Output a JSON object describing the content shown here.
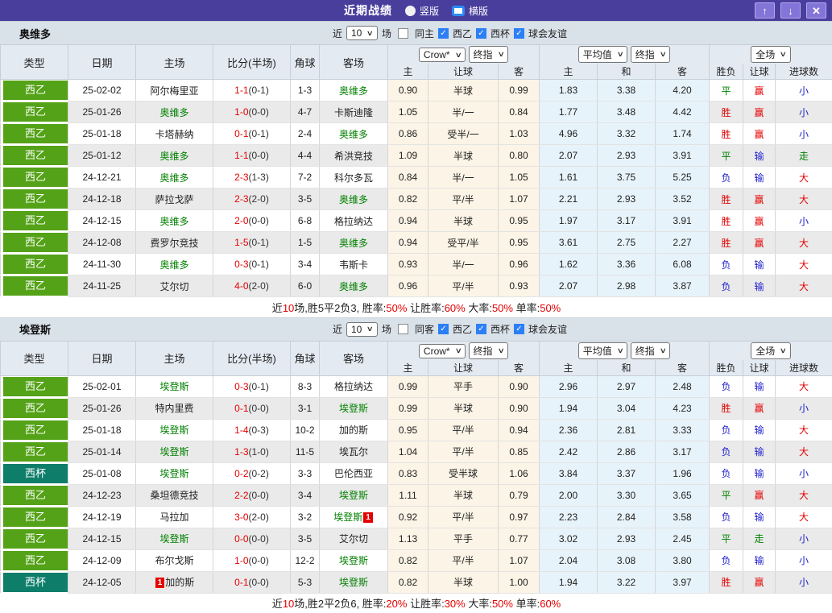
{
  "titlebar": {
    "title": "近期战绩",
    "vertical_label": "竖版",
    "horizontal_label": "横版",
    "up_glyph": "↑",
    "down_glyph": "↓",
    "close_glyph": "✕"
  },
  "colors": {
    "header_purple": "#4a3e9d",
    "button_purple": "#8374d8",
    "league_green": "#54a217",
    "cup_teal": "#0e7e6b",
    "win_red": "#e60000",
    "draw_green": "#008000",
    "lose_blue": "#2121cc",
    "band_gray": "#d9e1e9",
    "header_bg": "#e3eaf2",
    "odds_cream": "#fcf4e6",
    "avg_blue": "#e7f3fa",
    "checkbox_blue": "#2d7ff5"
  },
  "sections": [
    {
      "team": "奥维多",
      "filter": {
        "near": "近",
        "count": "10",
        "games": "场",
        "same": "同主",
        "leagues": [
          "西乙",
          "西杯",
          "球会友谊"
        ]
      },
      "header": {
        "cols": [
          "类型",
          "日期",
          "主场",
          "比分(半场)",
          "角球",
          "客场"
        ],
        "odds_select": "Crow*",
        "odds_final": "终指",
        "avg_select": "平均值",
        "avg_final": "终指",
        "full_select": "全场",
        "sub": [
          "主",
          "让球",
          "客",
          "主",
          "和",
          "客",
          "胜负",
          "让球",
          "进球数"
        ]
      },
      "rows": [
        {
          "lg": "西乙",
          "lc": "g",
          "date": "25-02-02",
          "home": "阿尔梅里亚",
          "ht": false,
          "hb": "",
          "ft": "1-1",
          "hf": "(0-1)",
          "cn": "1-3",
          "away": "奥维多",
          "at": true,
          "ab": "",
          "o": [
            "0.90",
            "半球",
            "0.99"
          ],
          "a": [
            "1.83",
            "3.38",
            "4.20"
          ],
          "r": [
            [
              "平",
              "g"
            ],
            [
              "赢",
              "r"
            ],
            [
              "小",
              "b"
            ]
          ]
        },
        {
          "lg": "西乙",
          "lc": "g",
          "date": "25-01-26",
          "home": "奥维多",
          "ht": true,
          "hb": "",
          "ft": "1-0",
          "hf": "(0-0)",
          "cn": "4-7",
          "away": "卡斯迪隆",
          "at": false,
          "ab": "",
          "o": [
            "1.05",
            "半/一",
            "0.84"
          ],
          "a": [
            "1.77",
            "3.48",
            "4.42"
          ],
          "r": [
            [
              "胜",
              "r"
            ],
            [
              "赢",
              "r"
            ],
            [
              "小",
              "b"
            ]
          ]
        },
        {
          "lg": "西乙",
          "lc": "g",
          "date": "25-01-18",
          "home": "卡塔赫纳",
          "ht": false,
          "hb": "",
          "ft": "0-1",
          "hf": "(0-1)",
          "cn": "2-4",
          "away": "奥维多",
          "at": true,
          "ab": "",
          "o": [
            "0.86",
            "受半/一",
            "1.03"
          ],
          "a": [
            "4.96",
            "3.32",
            "1.74"
          ],
          "r": [
            [
              "胜",
              "r"
            ],
            [
              "赢",
              "r"
            ],
            [
              "小",
              "b"
            ]
          ]
        },
        {
          "lg": "西乙",
          "lc": "g",
          "date": "25-01-12",
          "home": "奥维多",
          "ht": true,
          "hb": "",
          "ft": "1-1",
          "hf": "(0-0)",
          "cn": "4-4",
          "away": "希洪竞技",
          "at": false,
          "ab": "",
          "o": [
            "1.09",
            "半球",
            "0.80"
          ],
          "a": [
            "2.07",
            "2.93",
            "3.91"
          ],
          "r": [
            [
              "平",
              "g"
            ],
            [
              "输",
              "b"
            ],
            [
              "走",
              "g"
            ]
          ]
        },
        {
          "lg": "西乙",
          "lc": "g",
          "date": "24-12-21",
          "home": "奥维多",
          "ht": true,
          "hb": "",
          "ft": "2-3",
          "hf": "(1-3)",
          "cn": "7-2",
          "away": "科尔多瓦",
          "at": false,
          "ab": "",
          "o": [
            "0.84",
            "半/一",
            "1.05"
          ],
          "a": [
            "1.61",
            "3.75",
            "5.25"
          ],
          "r": [
            [
              "负",
              "b"
            ],
            [
              "输",
              "b"
            ],
            [
              "大",
              "r"
            ]
          ]
        },
        {
          "lg": "西乙",
          "lc": "g",
          "date": "24-12-18",
          "home": "萨拉戈萨",
          "ht": false,
          "hb": "",
          "ft": "2-3",
          "hf": "(2-0)",
          "cn": "3-5",
          "away": "奥维多",
          "at": true,
          "ab": "",
          "o": [
            "0.82",
            "平/半",
            "1.07"
          ],
          "a": [
            "2.21",
            "2.93",
            "3.52"
          ],
          "r": [
            [
              "胜",
              "r"
            ],
            [
              "赢",
              "r"
            ],
            [
              "大",
              "r"
            ]
          ]
        },
        {
          "lg": "西乙",
          "lc": "g",
          "date": "24-12-15",
          "home": "奥维多",
          "ht": true,
          "hb": "",
          "ft": "2-0",
          "hf": "(0-0)",
          "cn": "6-8",
          "away": "格拉纳达",
          "at": false,
          "ab": "",
          "o": [
            "0.94",
            "半球",
            "0.95"
          ],
          "a": [
            "1.97",
            "3.17",
            "3.91"
          ],
          "r": [
            [
              "胜",
              "r"
            ],
            [
              "赢",
              "r"
            ],
            [
              "小",
              "b"
            ]
          ]
        },
        {
          "lg": "西乙",
          "lc": "g",
          "date": "24-12-08",
          "home": "费罗尔竞技",
          "ht": false,
          "hb": "",
          "ft": "1-5",
          "hf": "(0-1)",
          "cn": "1-5",
          "away": "奥维多",
          "at": true,
          "ab": "",
          "o": [
            "0.94",
            "受平/半",
            "0.95"
          ],
          "a": [
            "3.61",
            "2.75",
            "2.27"
          ],
          "r": [
            [
              "胜",
              "r"
            ],
            [
              "赢",
              "r"
            ],
            [
              "大",
              "r"
            ]
          ]
        },
        {
          "lg": "西乙",
          "lc": "g",
          "date": "24-11-30",
          "home": "奥维多",
          "ht": true,
          "hb": "",
          "ft": "0-3",
          "hf": "(0-1)",
          "cn": "3-4",
          "away": "韦斯卡",
          "at": false,
          "ab": "",
          "o": [
            "0.93",
            "半/一",
            "0.96"
          ],
          "a": [
            "1.62",
            "3.36",
            "6.08"
          ],
          "r": [
            [
              "负",
              "b"
            ],
            [
              "输",
              "b"
            ],
            [
              "大",
              "r"
            ]
          ]
        },
        {
          "lg": "西乙",
          "lc": "g",
          "date": "24-11-25",
          "home": "艾尔切",
          "ht": false,
          "hb": "",
          "ft": "4-0",
          "hf": "(2-0)",
          "cn": "6-0",
          "away": "奥维多",
          "at": true,
          "ab": "",
          "o": [
            "0.96",
            "平/半",
            "0.93"
          ],
          "a": [
            "2.07",
            "2.98",
            "3.87"
          ],
          "r": [
            [
              "负",
              "b"
            ],
            [
              "输",
              "b"
            ],
            [
              "大",
              "r"
            ]
          ]
        }
      ],
      "summary": [
        [
          "近",
          "k"
        ],
        [
          "10",
          "r"
        ],
        [
          "场,胜5平2负3, 胜率:",
          "k"
        ],
        [
          "50%",
          "r"
        ],
        [
          " 让胜率:",
          "k"
        ],
        [
          "60%",
          "r"
        ],
        [
          " 大率:",
          "k"
        ],
        [
          "50%",
          "r"
        ],
        [
          " 单率:",
          "k"
        ],
        [
          "50%",
          "r"
        ]
      ]
    },
    {
      "team": "埃登斯",
      "filter": {
        "near": "近",
        "count": "10",
        "games": "场",
        "same": "同客",
        "leagues": [
          "西乙",
          "西杯",
          "球会友谊"
        ]
      },
      "header": {
        "cols": [
          "类型",
          "日期",
          "主场",
          "比分(半场)",
          "角球",
          "客场"
        ],
        "odds_select": "Crow*",
        "odds_final": "终指",
        "avg_select": "平均值",
        "avg_final": "终指",
        "full_select": "全场",
        "sub": [
          "主",
          "让球",
          "客",
          "主",
          "和",
          "客",
          "胜负",
          "让球",
          "进球数"
        ]
      },
      "rows": [
        {
          "lg": "西乙",
          "lc": "g",
          "date": "25-02-01",
          "home": "埃登斯",
          "ht": true,
          "hb": "",
          "ft": "0-3",
          "hf": "(0-1)",
          "cn": "8-3",
          "away": "格拉纳达",
          "at": false,
          "ab": "",
          "o": [
            "0.99",
            "平手",
            "0.90"
          ],
          "a": [
            "2.96",
            "2.97",
            "2.48"
          ],
          "r": [
            [
              "负",
              "b"
            ],
            [
              "输",
              "b"
            ],
            [
              "大",
              "r"
            ]
          ]
        },
        {
          "lg": "西乙",
          "lc": "g",
          "date": "25-01-26",
          "home": "特内里费",
          "ht": false,
          "hb": "",
          "ft": "0-1",
          "hf": "(0-0)",
          "cn": "3-1",
          "away": "埃登斯",
          "at": true,
          "ab": "",
          "o": [
            "0.99",
            "半球",
            "0.90"
          ],
          "a": [
            "1.94",
            "3.04",
            "4.23"
          ],
          "r": [
            [
              "胜",
              "r"
            ],
            [
              "赢",
              "r"
            ],
            [
              "小",
              "b"
            ]
          ]
        },
        {
          "lg": "西乙",
          "lc": "g",
          "date": "25-01-18",
          "home": "埃登斯",
          "ht": true,
          "hb": "",
          "ft": "1-4",
          "hf": "(0-3)",
          "cn": "10-2",
          "away": "加的斯",
          "at": false,
          "ab": "",
          "o": [
            "0.95",
            "平/半",
            "0.94"
          ],
          "a": [
            "2.36",
            "2.81",
            "3.33"
          ],
          "r": [
            [
              "负",
              "b"
            ],
            [
              "输",
              "b"
            ],
            [
              "大",
              "r"
            ]
          ]
        },
        {
          "lg": "西乙",
          "lc": "g",
          "date": "25-01-14",
          "home": "埃登斯",
          "ht": true,
          "hb": "",
          "ft": "1-3",
          "hf": "(1-0)",
          "cn": "11-5",
          "away": "埃瓦尔",
          "at": false,
          "ab": "",
          "o": [
            "1.04",
            "平/半",
            "0.85"
          ],
          "a": [
            "2.42",
            "2.86",
            "3.17"
          ],
          "r": [
            [
              "负",
              "b"
            ],
            [
              "输",
              "b"
            ],
            [
              "大",
              "r"
            ]
          ]
        },
        {
          "lg": "西杯",
          "lc": "t",
          "date": "25-01-08",
          "home": "埃登斯",
          "ht": true,
          "hb": "",
          "ft": "0-2",
          "hf": "(0-2)",
          "cn": "3-3",
          "away": "巴伦西亚",
          "at": false,
          "ab": "",
          "o": [
            "0.83",
            "受半球",
            "1.06"
          ],
          "a": [
            "3.84",
            "3.37",
            "1.96"
          ],
          "r": [
            [
              "负",
              "b"
            ],
            [
              "输",
              "b"
            ],
            [
              "小",
              "b"
            ]
          ]
        },
        {
          "lg": "西乙",
          "lc": "g",
          "date": "24-12-23",
          "home": "桑坦德竞技",
          "ht": false,
          "hb": "",
          "ft": "2-2",
          "hf": "(0-0)",
          "cn": "3-4",
          "away": "埃登斯",
          "at": true,
          "ab": "",
          "o": [
            "1.11",
            "半球",
            "0.79"
          ],
          "a": [
            "2.00",
            "3.30",
            "3.65"
          ],
          "r": [
            [
              "平",
              "g"
            ],
            [
              "赢",
              "r"
            ],
            [
              "大",
              "r"
            ]
          ]
        },
        {
          "lg": "西乙",
          "lc": "g",
          "date": "24-12-19",
          "home": "马拉加",
          "ht": false,
          "hb": "",
          "ft": "3-0",
          "hf": "(2-0)",
          "cn": "3-2",
          "away": "埃登斯",
          "at": true,
          "ab": "1",
          "o": [
            "0.92",
            "平/半",
            "0.97"
          ],
          "a": [
            "2.23",
            "2.84",
            "3.58"
          ],
          "r": [
            [
              "负",
              "b"
            ],
            [
              "输",
              "b"
            ],
            [
              "大",
              "r"
            ]
          ]
        },
        {
          "lg": "西乙",
          "lc": "g",
          "date": "24-12-15",
          "home": "埃登斯",
          "ht": true,
          "hb": "",
          "ft": "0-0",
          "hf": "(0-0)",
          "cn": "3-5",
          "away": "艾尔切",
          "at": false,
          "ab": "",
          "o": [
            "1.13",
            "平手",
            "0.77"
          ],
          "a": [
            "3.02",
            "2.93",
            "2.45"
          ],
          "r": [
            [
              "平",
              "g"
            ],
            [
              "走",
              "g"
            ],
            [
              "小",
              "b"
            ]
          ]
        },
        {
          "lg": "西乙",
          "lc": "g",
          "date": "24-12-09",
          "home": "布尔戈斯",
          "ht": false,
          "hb": "",
          "ft": "1-0",
          "hf": "(0-0)",
          "cn": "12-2",
          "away": "埃登斯",
          "at": true,
          "ab": "",
          "o": [
            "0.82",
            "平/半",
            "1.07"
          ],
          "a": [
            "2.04",
            "3.08",
            "3.80"
          ],
          "r": [
            [
              "负",
              "b"
            ],
            [
              "输",
              "b"
            ],
            [
              "小",
              "b"
            ]
          ]
        },
        {
          "lg": "西杯",
          "lc": "t",
          "date": "24-12-05",
          "home": "加的斯",
          "ht": false,
          "hb": "1",
          "ft": "0-1",
          "hf": "(0-0)",
          "cn": "5-3",
          "away": "埃登斯",
          "at": true,
          "ab": "",
          "o": [
            "0.82",
            "半球",
            "1.00"
          ],
          "a": [
            "1.94",
            "3.22",
            "3.97"
          ],
          "r": [
            [
              "胜",
              "r"
            ],
            [
              "赢",
              "r"
            ],
            [
              "小",
              "b"
            ]
          ]
        }
      ],
      "summary": [
        [
          "近",
          "k"
        ],
        [
          "10",
          "r"
        ],
        [
          "场,胜2平2负6, 胜率:",
          "k"
        ],
        [
          "20%",
          "r"
        ],
        [
          " 让胜率:",
          "k"
        ],
        [
          "30%",
          "r"
        ],
        [
          " 大率:",
          "k"
        ],
        [
          "50%",
          "r"
        ],
        [
          " 单率:",
          "k"
        ],
        [
          "60%",
          "r"
        ]
      ]
    }
  ]
}
